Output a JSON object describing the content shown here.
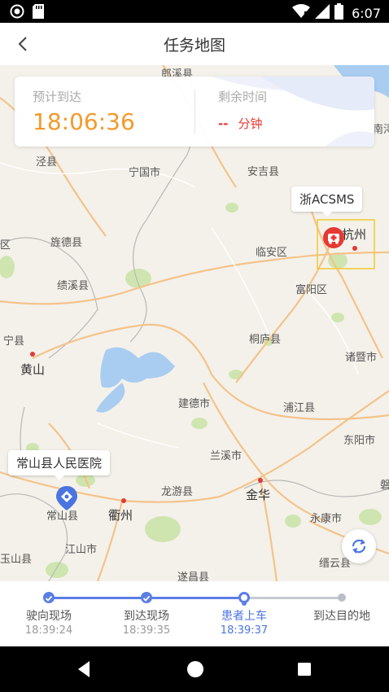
{
  "status_bar": {
    "time": "6:07"
  },
  "header": {
    "title": "任务地图",
    "back_icon": "chevron-left-icon"
  },
  "eta": {
    "label": "预计到达",
    "time": "18:06:36",
    "remaining_label": "剩余时间",
    "remaining_value": "--",
    "remaining_unit": "分钟",
    "accent_color": "#f39a2b",
    "alert_color": "#e53935"
  },
  "map": {
    "destination_name": "浙ACSMS",
    "origin_name": "常山县人民医院",
    "labels": {
      "langxi": "郎溪县",
      "jing": "泾县",
      "ningguo": "宁国市",
      "anji": "安吉县",
      "nanxun": "南浔",
      "jingde": "旌德县",
      "jixi": "绩溪县",
      "linan": "临安区",
      "hangzhou": "杭州",
      "fuyang": "富阳区",
      "ningk": "宁县",
      "huangshan": "黄山",
      "tonglu": "桐庐县",
      "zhuji": "诸暨市",
      "jiande": "建德市",
      "pujiang": "浦江县",
      "dongyang": "东阳市",
      "lanxi": "兰溪市",
      "changshan": "常山县",
      "quzhou": "衢州",
      "longyou": "龙游县",
      "jinhua": "金华",
      "yongkang": "永康市",
      "jiangshan": "江山市",
      "yushan": "玉山县",
      "suichang": "遂昌县",
      "jinyun": "缙云县",
      "qu": "区",
      "pan": "磐"
    }
  },
  "progress": {
    "steps": [
      {
        "name": "驶向现场",
        "time": "18:39:24"
      },
      {
        "name": "到达现场",
        "time": "18:39:35"
      },
      {
        "name": "患者上车",
        "time": "18:39:37"
      },
      {
        "name": "到达目的地",
        "time": ""
      }
    ],
    "completed_color": "#5b7ee5",
    "pending_color": "#b9bec7"
  }
}
